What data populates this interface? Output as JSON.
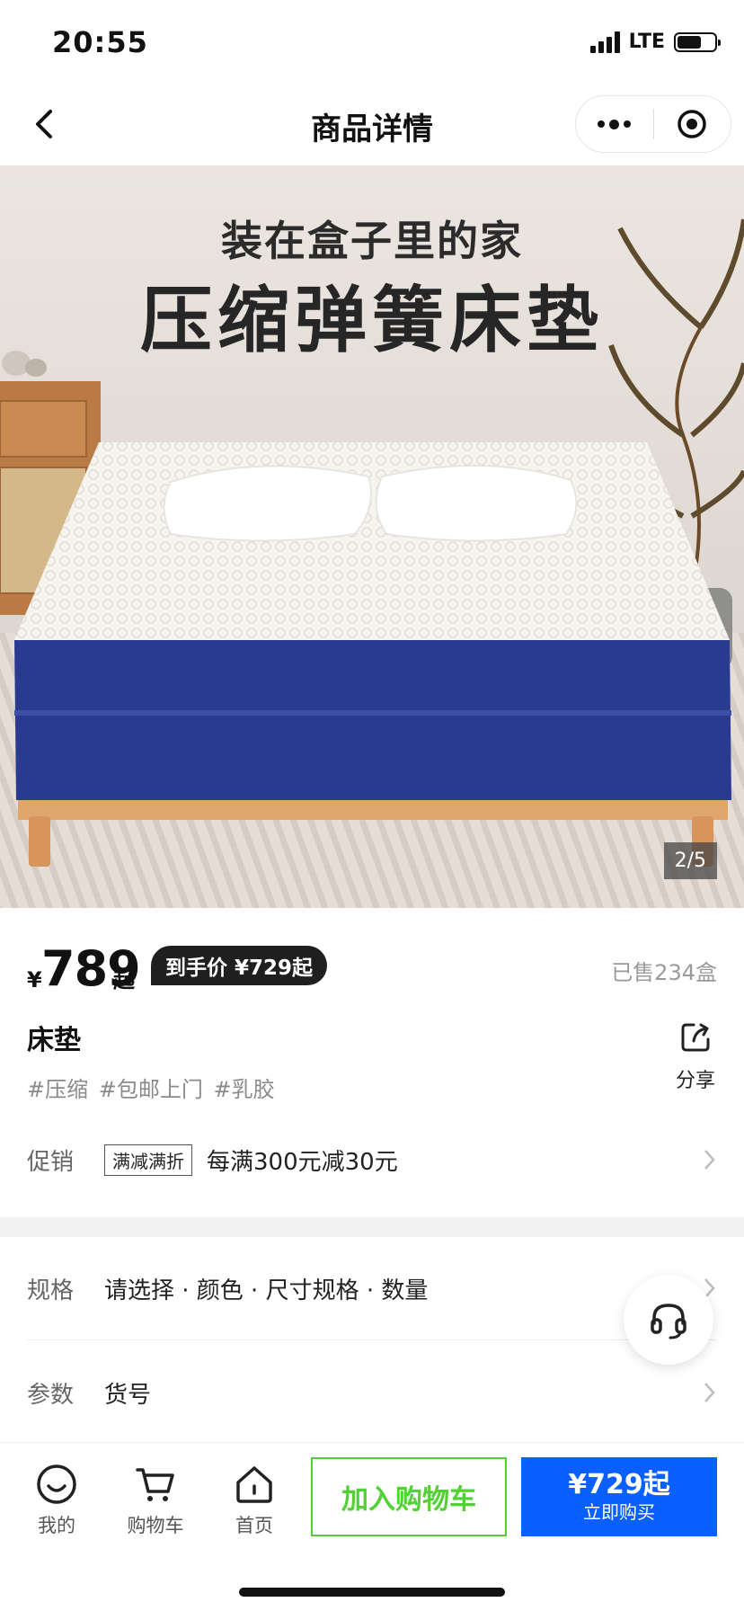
{
  "status_bar": {
    "time": "20:55",
    "network": "LTE",
    "battery_level": 0.65
  },
  "nav": {
    "title": "商品详情"
  },
  "hero": {
    "caption_line1": "装在盒子里的家",
    "caption_line2": "压缩弹簧床垫",
    "page_indicator": "2/5"
  },
  "price": {
    "currency": "¥",
    "value": "789",
    "suffix": "起",
    "final_price_badge": "到手价 ¥729起",
    "sold": "已售234盒"
  },
  "product": {
    "title": "床垫",
    "tags": "#压缩 #包邮上门 #乳胶",
    "share_label": "分享"
  },
  "promo": {
    "label": "促销",
    "tag": "满减满折",
    "text": "每满300元减30元"
  },
  "spec": {
    "label": "规格",
    "text": "请选择 · 颜色 · 尺寸规格 · 数量"
  },
  "params": {
    "label": "参数",
    "text": "货号"
  },
  "bottom_bar": {
    "mine": "我的",
    "cart": "购物车",
    "home": "首页",
    "add_to_cart": "加入购物车",
    "buy_price": "¥729起",
    "buy_label": "立即购买"
  },
  "colors": {
    "accent_green": "#52d134",
    "buy_blue": "#0a5fff",
    "mattress_blue": "#2a3a8f"
  },
  "icons": [
    "back-chevron-icon",
    "more-icon",
    "target-icon",
    "share-icon",
    "chevron-right-icon",
    "headset-icon",
    "smiley-icon",
    "cart-icon",
    "home-icon"
  ]
}
